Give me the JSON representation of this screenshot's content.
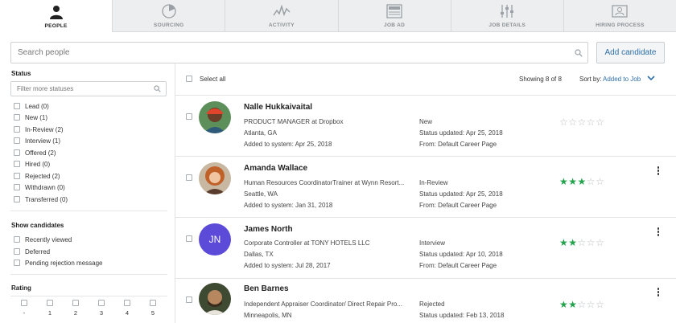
{
  "tabs": [
    {
      "label": "PEOPLE",
      "icon": "person-icon",
      "active": true
    },
    {
      "label": "SOURCING",
      "icon": "pie-chart-icon",
      "active": false
    },
    {
      "label": "ACTIVITY",
      "icon": "activity-icon",
      "active": false
    },
    {
      "label": "JOB AD",
      "icon": "document-icon",
      "active": false
    },
    {
      "label": "JOB DETAILS",
      "icon": "sliders-icon",
      "active": false
    },
    {
      "label": "HIRING PROCESS",
      "icon": "id-card-icon",
      "active": false
    }
  ],
  "search": {
    "placeholder": "Search people"
  },
  "add_candidate": "Add candidate",
  "sidebar": {
    "status_title": "Status",
    "filter_placeholder": "Filter more statuses",
    "statuses": [
      "Lead (0)",
      "New (1)",
      "In-Review (2)",
      "Interview (1)",
      "Offered (2)",
      "Hired (0)",
      "Rejected (2)",
      "Withdrawn (0)",
      "Transferred (0)"
    ],
    "show_title": "Show candidates",
    "show_options": [
      "Recently viewed",
      "Deferred",
      "Pending rejection message"
    ],
    "rating_title": "Rating",
    "rating_options": [
      "-",
      "1",
      "2",
      "3",
      "4",
      "5"
    ]
  },
  "list": {
    "select_all": "Select all",
    "showing": "Showing 8 of 8",
    "sort_label": "Sort by:",
    "sort_value": "Added to Job"
  },
  "candidates": [
    {
      "name": "Nalle Hukkaivaital",
      "title": "PRODUCT MANAGER at Dropbox",
      "location": "Atlanta, GA",
      "added": "Added to system: Apr 25, 2018",
      "status": "New",
      "updated": "Status updated: Apr 25, 2018",
      "from": "From: Default Career Page",
      "rating": 0,
      "avatar": "photo-avatar"
    },
    {
      "name": "Amanda Wallace",
      "title": "Human Resources CoordinatorTrainer at Wynn Resort...",
      "location": "Seattle, WA",
      "added": "Added to system: Jan 31, 2018",
      "status": "In-Review",
      "updated": "Status updated: Apr 25, 2018",
      "from": "From: Default Career Page",
      "rating": 3,
      "avatar": "photo-avatar"
    },
    {
      "name": "James North",
      "initials": "JN",
      "title": "Corporate Controller at TONY HOTELS LLC",
      "location": "Dallas, TX",
      "added": "Added to system: Jul 28, 2017",
      "status": "Interview",
      "updated": "Status updated: Apr 10, 2018",
      "from": "From: Default Career Page",
      "rating": 2,
      "avatar": "initials-avatar"
    },
    {
      "name": "Ben Barnes",
      "title": "Independent Appraiser Coordinator/ Direct Repair Pro...",
      "location": "Minneapolis, MN",
      "added": "",
      "status": "Rejected",
      "updated": "Status updated: Feb 13, 2018",
      "from": "",
      "rating": 2,
      "avatar": "photo-avatar"
    }
  ],
  "colors": {
    "accent": "#2f6fa8",
    "star": "#22a24a",
    "initials_bg": "#5b4bd8"
  }
}
